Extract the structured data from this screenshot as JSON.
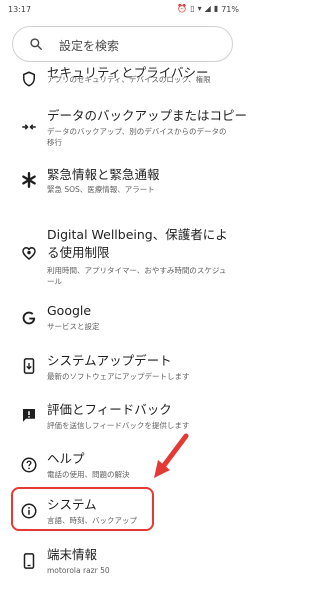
{
  "status": {
    "time": "13:17",
    "battery": "71%"
  },
  "search": {
    "placeholder": "設定を検索"
  },
  "items": [
    {
      "title": "セキュリティとプライバシー",
      "subtitle": "アプリのセキュリティ、デバイスのロック、権限",
      "icon": "shield-icon"
    },
    {
      "title": "データのバックアップまたはコピー",
      "subtitle": "データのバックアップ、別のデバイスからのデータの移行",
      "icon": "data-transfer-icon"
    },
    {
      "title": "緊急情報と緊急通報",
      "subtitle": "緊急 SOS、医療情報、アラート",
      "icon": "asterisk-icon"
    },
    {
      "title": "Digital Wellbeing、保護者による使用制限",
      "subtitle": "利用時間、アプリタイマー、おやすみ時間のスケジュール",
      "icon": "wellbeing-icon"
    },
    {
      "title": "Google",
      "subtitle": "サービスと設定",
      "icon": "google-icon"
    },
    {
      "title": "システムアップデート",
      "subtitle": "最新のソフトウェアにアップデートします",
      "icon": "system-update-icon"
    },
    {
      "title": "評価とフィードバック",
      "subtitle": "評価を送信しフィードバックを提供します",
      "icon": "feedback-icon"
    },
    {
      "title": "ヘルプ",
      "subtitle": "電話の使用、問題の解決",
      "icon": "help-icon"
    },
    {
      "title": "システム",
      "subtitle": "言語、時刻、バックアップ",
      "icon": "info-icon"
    },
    {
      "title": "端末情報",
      "subtitle": "motorola razr 50",
      "icon": "phone-icon"
    }
  ],
  "colors": {
    "highlight": "#e53935",
    "text_primary": "#1f1f1f",
    "text_secondary": "#5f5f5f"
  }
}
